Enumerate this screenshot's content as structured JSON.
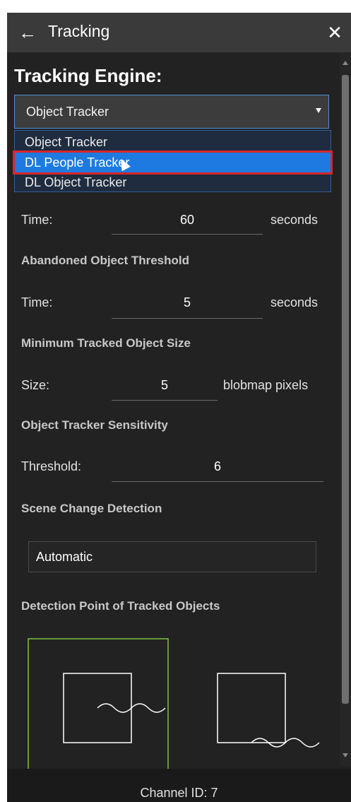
{
  "header": {
    "title": "Tracking",
    "back_icon": "←",
    "close_icon": "✕"
  },
  "engine": {
    "heading": "Tracking Engine:",
    "selected": "Object Tracker",
    "options": [
      "Object Tracker",
      "DL People Tracker",
      "DL Object Tracker"
    ],
    "highlighted_index": 1
  },
  "timing": {
    "time_label": "Time:",
    "time_value": "60",
    "time_unit": "seconds"
  },
  "abandoned": {
    "heading": "Abandoned Object Threshold",
    "time_label": "Time:",
    "time_value": "5",
    "time_unit": "seconds"
  },
  "min_size": {
    "heading": "Minimum Tracked Object Size",
    "size_label": "Size:",
    "size_value": "5",
    "size_unit": "blobmap pixels"
  },
  "sensitivity": {
    "heading": "Object Tracker Sensitivity",
    "threshold_label": "Threshold:",
    "threshold_value": "6"
  },
  "scene_change": {
    "heading": "Scene Change Detection",
    "value": "Automatic"
  },
  "detection_point": {
    "heading": "Detection Point of Tracked Objects"
  },
  "footer": {
    "channel_label": "Channel ID: 7"
  },
  "colors": {
    "accent": "#1e7ae0",
    "highlight_border": "#d9262a",
    "selected_frame": "#7dc242",
    "panel_bg": "#222222"
  }
}
